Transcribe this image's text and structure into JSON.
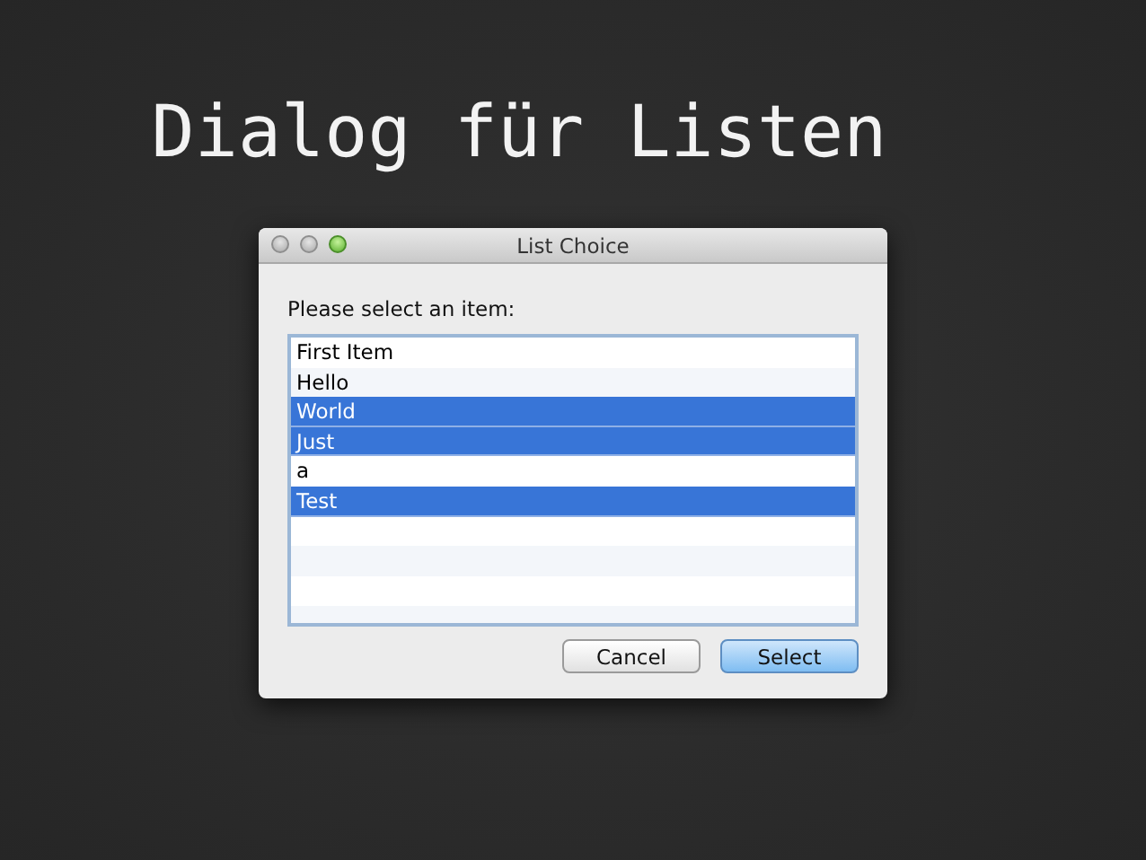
{
  "slide_title": "Dialog für Listen",
  "window": {
    "title": "List Choice"
  },
  "prompt": "Please select an item:",
  "list": {
    "items": [
      {
        "label": "First Item",
        "selected": false
      },
      {
        "label": "Hello",
        "selected": false
      },
      {
        "label": "World",
        "selected": true
      },
      {
        "label": "Just",
        "selected": true
      },
      {
        "label": "a",
        "selected": false
      },
      {
        "label": "Test",
        "selected": true
      }
    ]
  },
  "buttons": [
    {
      "label": "Cancel",
      "kind": "normal"
    },
    {
      "label": "Select",
      "kind": "default"
    }
  ]
}
